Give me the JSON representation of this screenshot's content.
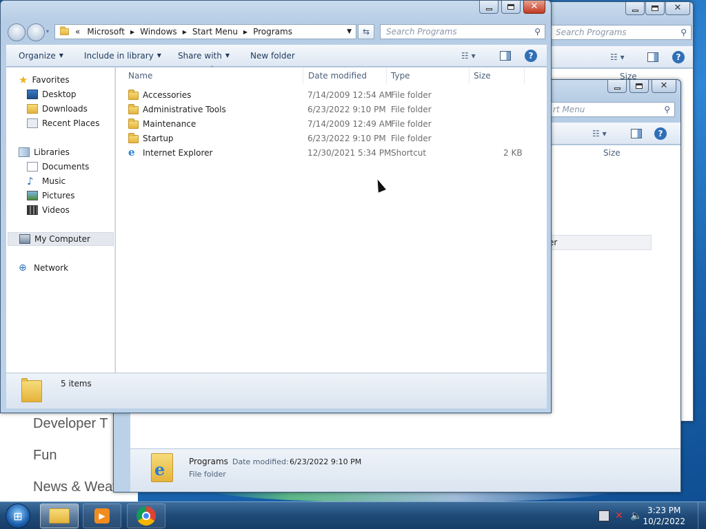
{
  "background": {
    "page_items": [
      "Developer T",
      "Fun",
      "News & Weather"
    ]
  },
  "window_back": {
    "search_placeholder": "Search Programs"
  },
  "window_middle": {
    "search_fragment": "rt Menu",
    "size_col": "Size",
    "row_fragment": "er",
    "details": {
      "name": "Programs",
      "date_label": "Date modified:",
      "date_value": "6/23/2022 9:10 PM",
      "type": "File folder"
    }
  },
  "window": {
    "breadcrumb": [
      "«",
      "Microsoft",
      "Windows",
      "Start Menu",
      "Programs"
    ],
    "search_placeholder": "Search Programs",
    "toolbar": {
      "organize": "Organize",
      "include": "Include in library",
      "share": "Share with",
      "new_folder": "New folder"
    },
    "nav": {
      "favorites": "Favorites",
      "desktop": "Desktop",
      "downloads": "Downloads",
      "recent": "Recent Places",
      "libraries": "Libraries",
      "documents": "Documents",
      "music": "Music",
      "pictures": "Pictures",
      "videos": "Videos",
      "computer": "My Computer",
      "network": "Network"
    },
    "columns": {
      "name": "Name",
      "date": "Date modified",
      "type": "Type",
      "size": "Size"
    },
    "files": [
      {
        "name": "Accessories",
        "date": "7/14/2009 12:54 AM",
        "type": "File folder",
        "size": "",
        "icon": "folder-icon"
      },
      {
        "name": "Administrative Tools",
        "date": "6/23/2022 9:10 PM",
        "type": "File folder",
        "size": "",
        "icon": "folder-icon"
      },
      {
        "name": "Maintenance",
        "date": "7/14/2009 12:49 AM",
        "type": "File folder",
        "size": "",
        "icon": "folder-icon"
      },
      {
        "name": "Startup",
        "date": "6/23/2022 9:10 PM",
        "type": "File folder",
        "size": "",
        "icon": "folder-icon"
      },
      {
        "name": "Internet Explorer",
        "date": "12/30/2021 5:34 PM",
        "type": "Shortcut",
        "size": "2 KB",
        "icon": "ie-shortcut-icon"
      }
    ],
    "status": "5 items"
  },
  "taskbar": {
    "time": "3:23 PM",
    "date": "10/2/2022"
  },
  "colors": {
    "accent": "#1e395b",
    "selection": "#dce8f5",
    "close": "#c23a23"
  }
}
